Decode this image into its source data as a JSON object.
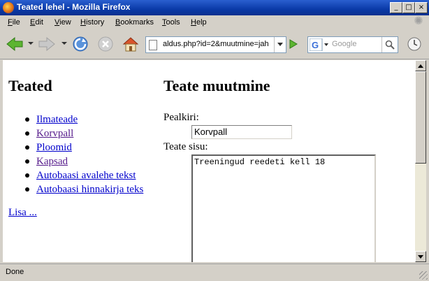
{
  "window": {
    "title": "Teated lehel - Mozilla Firefox",
    "controls": [
      "_",
      "□",
      "×"
    ]
  },
  "menubar": {
    "items": [
      {
        "label": "File",
        "accel": "F",
        "rest": "ile"
      },
      {
        "label": "Edit",
        "accel": "E",
        "rest": "dit"
      },
      {
        "label": "View",
        "accel": "V",
        "rest": "iew"
      },
      {
        "label": "History",
        "accel": "H",
        "rest": "istory"
      },
      {
        "label": "Bookmarks",
        "accel": "B",
        "rest": "ookmarks"
      },
      {
        "label": "Tools",
        "accel": "T",
        "rest": "ools"
      },
      {
        "label": "Help",
        "accel": "H",
        "rest": "elp"
      }
    ]
  },
  "toolbar": {
    "url": "aldus.php?id=2&muutmine=jah",
    "search_placeholder": "Google"
  },
  "page": {
    "sidebar": {
      "title": "Teated",
      "links": [
        {
          "label": "Ilmateade",
          "visited": false
        },
        {
          "label": "Korvpall",
          "visited": true
        },
        {
          "label": "Ploomid",
          "visited": false
        },
        {
          "label": "Kapsad",
          "visited": true
        },
        {
          "label": "Autobaasi avalehe tekst",
          "visited": false
        },
        {
          "label": "Autobaasi hinnakirja teks",
          "visited": false
        }
      ],
      "add_link": "Lisa ..."
    },
    "main": {
      "title": "Teate muutmine",
      "heading_label": "Pealkiri:",
      "heading_value": "Korvpall",
      "content_label": "Teate sisu:",
      "content_value": "Treeningud reedeti kell 18"
    }
  },
  "status": {
    "text": "Done"
  }
}
